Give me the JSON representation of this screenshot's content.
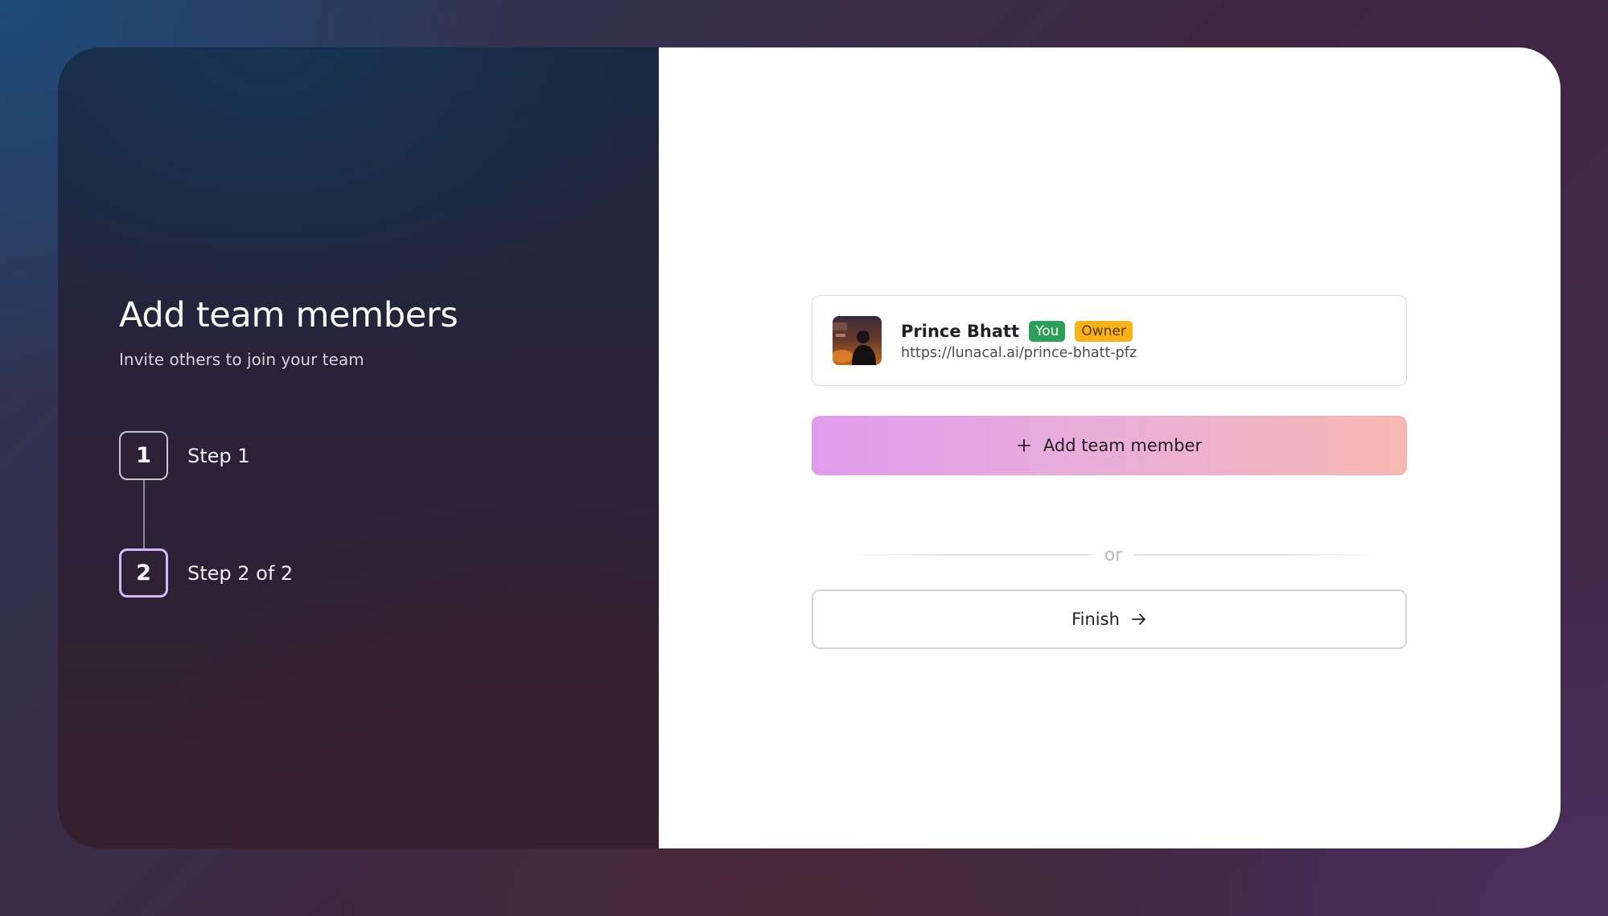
{
  "left_panel": {
    "title": "Add team members",
    "subtitle": "Invite others to join your team",
    "steps": [
      {
        "number": "1",
        "label": "Step 1",
        "active": false
      },
      {
        "number": "2",
        "label": "Step 2 of 2",
        "active": true
      }
    ]
  },
  "member": {
    "name": "Prince Bhatt",
    "badges": [
      "You",
      "Owner"
    ],
    "url": "https://lunacal.ai/prince-bhatt-pfz",
    "avatar_icon": "user-photo"
  },
  "actions": {
    "add_label": "Add team member",
    "divider_label": "or",
    "finish_label": "Finish"
  },
  "colors": {
    "accent_gradient_start": "#e19bee",
    "accent_gradient_end": "#f6b8b1",
    "badge_you": "#2e9e5b",
    "badge_owner": "#f7b21a",
    "active_step_border": "#d5b8f8"
  }
}
